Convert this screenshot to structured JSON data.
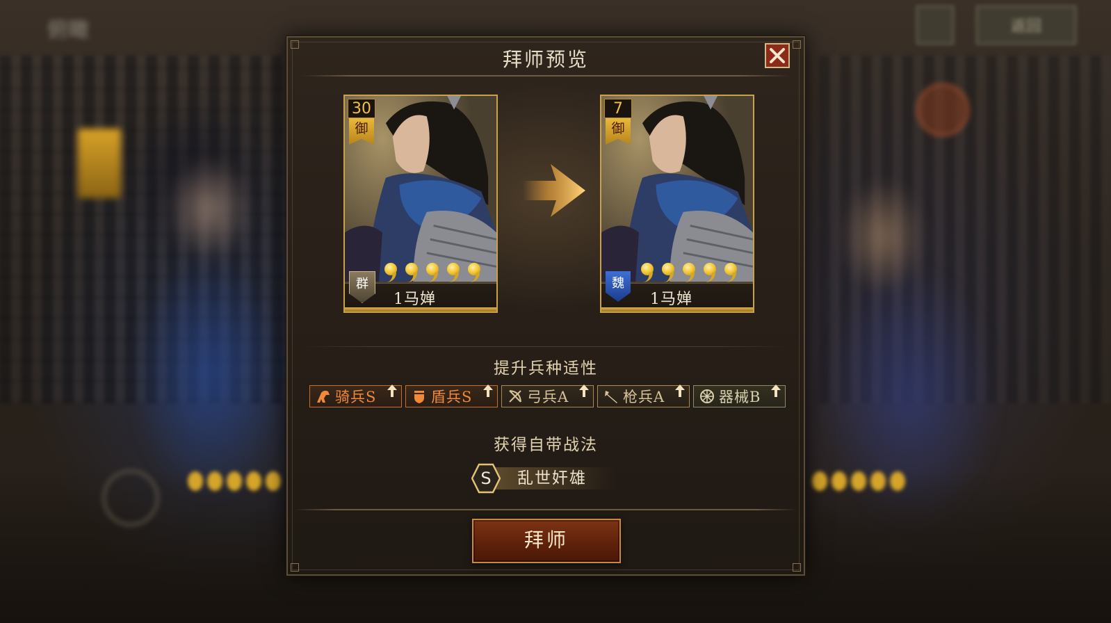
{
  "background": {
    "top_title": "俯瞰",
    "top_button": "返回"
  },
  "modal": {
    "title": "拜师预览",
    "close_icon": "close-icon",
    "cards": [
      {
        "level": "30",
        "role": "御",
        "faction": "群",
        "faction_color": "#6b5f48",
        "name": "1马婵",
        "stars": 5
      },
      {
        "level": "7",
        "role": "御",
        "faction": "魏",
        "faction_color": "#2a55c0",
        "name": "1马婵",
        "stars": 5
      }
    ],
    "troop_section_title": "提升兵种适性",
    "troops": [
      {
        "label": "骑兵S",
        "icon": "cavalry-icon",
        "tier": "S"
      },
      {
        "label": "盾兵S",
        "icon": "shield-icon",
        "tier": "S"
      },
      {
        "label": "弓兵A",
        "icon": "bow-icon",
        "tier": "A"
      },
      {
        "label": "枪兵A",
        "icon": "spear-icon",
        "tier": "A"
      },
      {
        "label": "器械B",
        "icon": "siege-wheel-icon",
        "tier": "B"
      }
    ],
    "skill_section_title": "获得自带战法",
    "skill": {
      "grade": "S",
      "name": "乱世奸雄"
    },
    "confirm_button": "拜师"
  },
  "colors": {
    "accent_gold": "#c9a24a",
    "s_tier": "#f08a3a",
    "button_red": "#7e3314"
  }
}
